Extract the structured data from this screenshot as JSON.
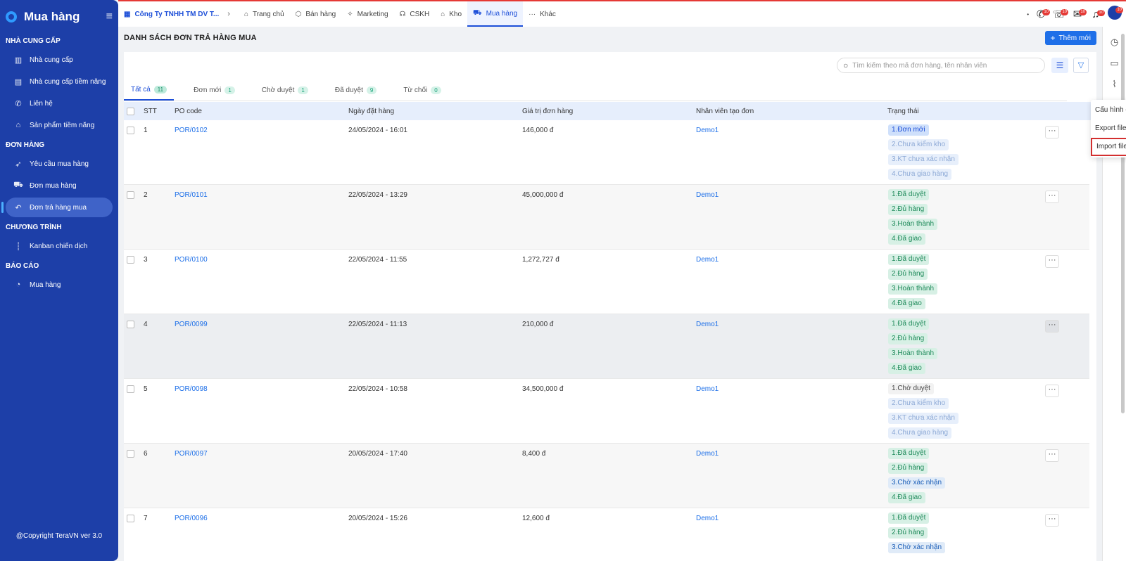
{
  "sidebar": {
    "title": "Mua hàng",
    "sections": [
      {
        "title": "NHÀ CUNG CẤP",
        "items": [
          {
            "label": "Nhà cung cấp",
            "icon": "building-icon"
          },
          {
            "label": "Nhà cung cấp tiềm năng",
            "icon": "building-star-icon"
          },
          {
            "label": "Liên hệ",
            "icon": "phone-icon"
          },
          {
            "label": "Sản phẩm tiềm năng",
            "icon": "box-icon"
          }
        ]
      },
      {
        "title": "ĐƠN HÀNG",
        "items": [
          {
            "label": "Yêu cầu mua hàng",
            "icon": "rocket-icon"
          },
          {
            "label": "Đơn mua hàng",
            "icon": "cart-icon"
          },
          {
            "label": "Đơn trả hàng mua",
            "icon": "return-icon",
            "active": true
          }
        ]
      },
      {
        "title": "CHƯƠNG TRÌNH",
        "items": [
          {
            "label": "Kanban chiến dịch",
            "icon": "kanban-icon"
          }
        ]
      },
      {
        "title": "BÁO CÁO",
        "items": [
          {
            "label": "Mua hàng",
            "icon": "chart-pie-icon"
          }
        ]
      }
    ],
    "footer": "@Copyright TeraVN ver 3.0"
  },
  "topbar": {
    "company": "Công Ty TNHH TM DV T...",
    "nav": [
      {
        "label": "Trang chủ",
        "icon": "home-icon"
      },
      {
        "label": "Bán hàng",
        "icon": "package-icon"
      },
      {
        "label": "Marketing",
        "icon": "megaphone-icon"
      },
      {
        "label": "CSKH",
        "icon": "headset-icon"
      },
      {
        "label": "Kho",
        "icon": "warehouse-icon"
      },
      {
        "label": "Mua hàng",
        "icon": "cart-icon",
        "active": true
      },
      {
        "label": "Khác",
        "icon": "dots-icon"
      }
    ],
    "badges": {
      "phone": "10",
      "chat": "10",
      "mail": "10",
      "bell": "10",
      "avatar": "10"
    }
  },
  "page": {
    "title": "DANH SÁCH ĐƠN TRẢ HÀNG MUA",
    "add_label": "Thêm mới",
    "search_placeholder": "Tìm kiếm theo mã đơn hàng, tên nhân viên"
  },
  "tabs": [
    {
      "label": "Tất cả",
      "count": "11",
      "active": true
    },
    {
      "label": "Đơn mới",
      "count": "1"
    },
    {
      "label": "Chờ duyệt",
      "count": "1"
    },
    {
      "label": "Đã duyệt",
      "count": "9"
    },
    {
      "label": "Từ chối",
      "count": "0"
    }
  ],
  "table": {
    "headers": {
      "stt": "STT",
      "po": "PO code",
      "date": "Ngày đặt hàng",
      "value": "Giá trị đơn hàng",
      "employee": "Nhân viên tạo đơn",
      "status": "Trạng thái"
    },
    "rows": [
      {
        "stt": "1",
        "po": "POR/0102",
        "date": "24/05/2024 - 16:01",
        "value": "146,000 đ",
        "employee": "Demo1",
        "status": [
          {
            "t": "1.Đơn mới",
            "c": "blue"
          },
          {
            "t": "2.Chưa kiểm kho",
            "c": "lblue"
          },
          {
            "t": "3.KT chưa xác nhận",
            "c": "lblue"
          },
          {
            "t": "4.Chưa giao hàng",
            "c": "lblue"
          }
        ]
      },
      {
        "stt": "2",
        "po": "POR/0101",
        "date": "22/05/2024 - 13:29",
        "value": "45,000,000 đ",
        "employee": "Demo1",
        "status": [
          {
            "t": "1.Đã duyệt",
            "c": "green"
          },
          {
            "t": "2.Đủ hàng",
            "c": "green"
          },
          {
            "t": "3.Hoàn thành",
            "c": "green"
          },
          {
            "t": "4.Đã giao",
            "c": "green"
          }
        ]
      },
      {
        "stt": "3",
        "po": "POR/0100",
        "date": "22/05/2024 - 11:55",
        "value": "1,272,727 đ",
        "employee": "Demo1",
        "status": [
          {
            "t": "1.Đã duyệt",
            "c": "green"
          },
          {
            "t": "2.Đủ hàng",
            "c": "green"
          },
          {
            "t": "3.Hoàn thành",
            "c": "green"
          },
          {
            "t": "4.Đã giao",
            "c": "green"
          }
        ]
      },
      {
        "stt": "4",
        "po": "POR/0099",
        "date": "22/05/2024 - 11:13",
        "value": "210,000 đ",
        "employee": "Demo1",
        "status": [
          {
            "t": "1.Đã duyệt",
            "c": "green"
          },
          {
            "t": "2.Đủ hàng",
            "c": "green"
          },
          {
            "t": "3.Hoàn thành",
            "c": "green"
          },
          {
            "t": "4.Đã giao",
            "c": "green"
          }
        ]
      },
      {
        "stt": "5",
        "po": "POR/0098",
        "date": "22/05/2024 - 10:58",
        "value": "34,500,000 đ",
        "employee": "Demo1",
        "status": [
          {
            "t": "1.Chờ duyệt",
            "c": "plain"
          },
          {
            "t": "2.Chưa kiểm kho",
            "c": "lblue"
          },
          {
            "t": "3.KT chưa xác nhận",
            "c": "lblue"
          },
          {
            "t": "4.Chưa giao hàng",
            "c": "lblue"
          }
        ]
      },
      {
        "stt": "6",
        "po": "POR/0097",
        "date": "20/05/2024 - 17:40",
        "value": "8,400 đ",
        "employee": "Demo1",
        "status": [
          {
            "t": "1.Đã duyệt",
            "c": "green"
          },
          {
            "t": "2.Đủ hàng",
            "c": "green"
          },
          {
            "t": "3.Chờ xác nhận",
            "c": "gblue"
          },
          {
            "t": "4.Đã giao",
            "c": "green"
          }
        ]
      },
      {
        "stt": "7",
        "po": "POR/0096",
        "date": "20/05/2024 - 15:26",
        "value": "12,600 đ",
        "employee": "Demo1",
        "status": [
          {
            "t": "1.Đã duyệt",
            "c": "green"
          },
          {
            "t": "2.Đủ hàng",
            "c": "green"
          },
          {
            "t": "3.Chờ xác nhận",
            "c": "gblue"
          }
        ]
      }
    ]
  },
  "dropdown": {
    "items": [
      {
        "label": "Cấu hình cột"
      },
      {
        "label": "Export file excel"
      },
      {
        "label": "Import file excel",
        "highlighted": true
      }
    ]
  },
  "colors": {
    "sidebar": "#1d3fa8",
    "primary": "#1e6fe8",
    "highlight": "#d32f2f"
  }
}
